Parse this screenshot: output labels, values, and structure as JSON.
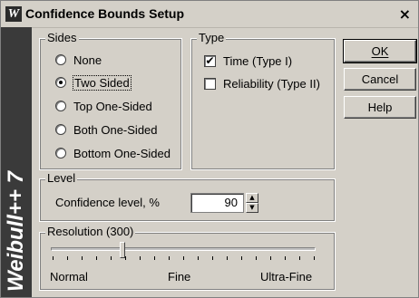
{
  "window": {
    "title": "Confidence Bounds Setup",
    "app_icon_glyph": "W",
    "close_glyph": "×",
    "brand_text": "Weibull++ 7"
  },
  "sides": {
    "legend": "Sides",
    "options": [
      {
        "label": "None",
        "checked": false
      },
      {
        "label": "Two Sided",
        "checked": true
      },
      {
        "label": "Top One-Sided",
        "checked": false
      },
      {
        "label": "Both One-Sided",
        "checked": false
      },
      {
        "label": "Bottom One-Sided",
        "checked": false
      }
    ]
  },
  "type": {
    "legend": "Type",
    "options": [
      {
        "label": "Time (Type I)",
        "checked": true
      },
      {
        "label": "Reliability (Type II)",
        "checked": false
      }
    ]
  },
  "buttons": {
    "ok_label": "OK",
    "cancel_label": "Cancel",
    "help_label": "Help"
  },
  "level": {
    "legend": "Level",
    "confidence_label": "Confidence level, %",
    "confidence_value": "90"
  },
  "resolution": {
    "legend": "Resolution (300)",
    "labels": [
      "Normal",
      "Fine",
      "Ultra-Fine"
    ],
    "slider_fraction": 0.27
  },
  "colors": {
    "dialog_bg": "#d4d0c8",
    "brand_band": "#3a3a3a"
  },
  "icons": {
    "close": "close-icon",
    "app": "weibull-app-icon",
    "check": "checkmark-icon"
  }
}
